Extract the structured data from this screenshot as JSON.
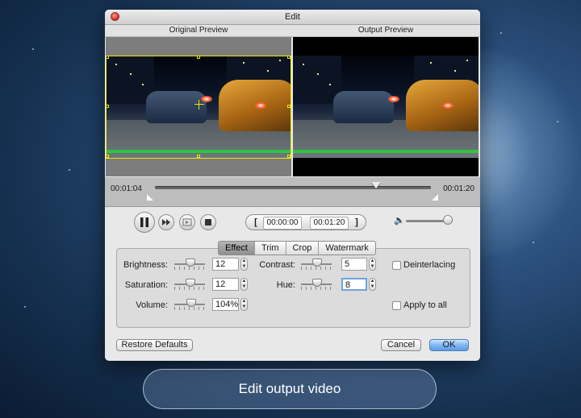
{
  "window": {
    "title": "Edit"
  },
  "preview": {
    "original_label": "Original Preview",
    "output_label": "Output Preview"
  },
  "timeline": {
    "current_time": "00:01:04",
    "end_time": "00:01:20",
    "position_fraction": 0.8
  },
  "playback": {
    "start_time": "00:00:00",
    "end_time": "00:01:20",
    "volume_fraction": 0.9
  },
  "tabs": [
    {
      "label": "Effect",
      "active": true
    },
    {
      "label": "Trim",
      "active": false
    },
    {
      "label": "Crop",
      "active": false
    },
    {
      "label": "Watermark",
      "active": false
    }
  ],
  "effects": {
    "brightness": {
      "label": "Brightness:",
      "value": "12"
    },
    "saturation": {
      "label": "Saturation:",
      "value": "12"
    },
    "volume": {
      "label": "Volume:",
      "value": "104%"
    },
    "contrast": {
      "label": "Contrast:",
      "value": "5"
    },
    "hue": {
      "label": "Hue:",
      "value": "8"
    }
  },
  "options": {
    "deinterlacing": {
      "label": "Deinterlacing",
      "checked": false
    },
    "apply_to_all": {
      "label": "Apply to all",
      "checked": false
    }
  },
  "buttons": {
    "restore": "Restore Defaults",
    "cancel": "Cancel",
    "ok": "OK"
  },
  "caption": "Edit output video"
}
